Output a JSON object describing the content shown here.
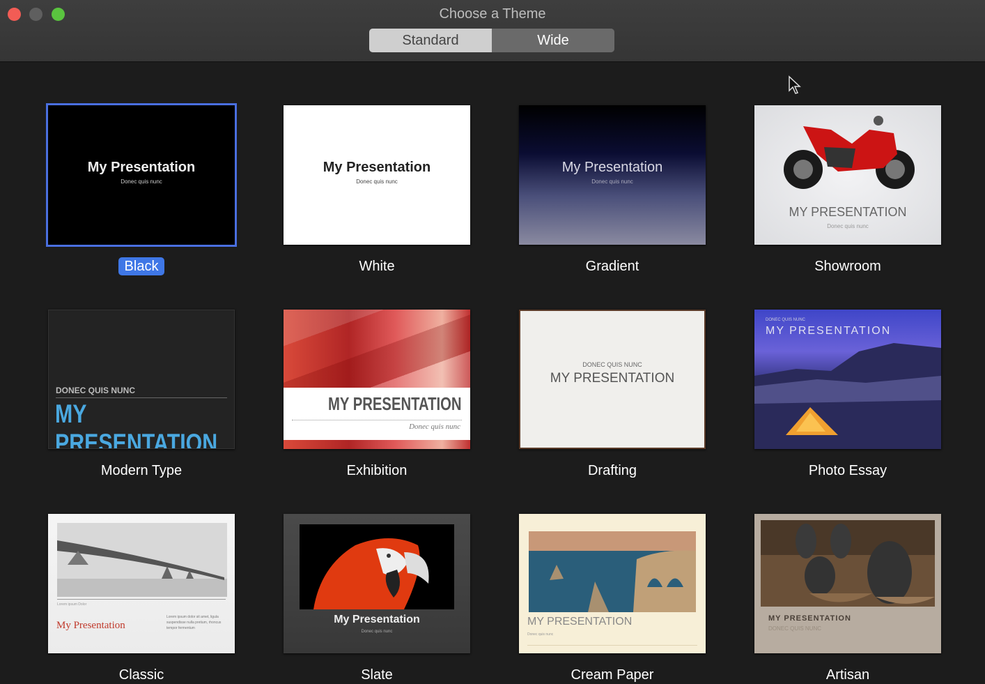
{
  "window": {
    "title": "Choose a Theme",
    "controls": [
      "close",
      "minimize",
      "zoom"
    ]
  },
  "segmented": {
    "options": [
      {
        "label": "Standard",
        "selected": true
      },
      {
        "label": "Wide",
        "selected": false
      }
    ]
  },
  "themes": [
    {
      "name": "Black",
      "selected": true,
      "title": "My Presentation",
      "subtitle": "Donec quis nunc"
    },
    {
      "name": "White",
      "selected": false,
      "title": "My Presentation",
      "subtitle": "Donec quis nunc"
    },
    {
      "name": "Gradient",
      "selected": false,
      "title": "My Presentation",
      "subtitle": "Donec quis nunc"
    },
    {
      "name": "Showroom",
      "selected": false,
      "title": "MY PRESENTATION",
      "subtitle": "Donec quis nunc"
    },
    {
      "name": "Modern Type",
      "selected": false,
      "title": "MY PRESENTATION",
      "subtitle": "DONEC QUIS NUNC"
    },
    {
      "name": "Exhibition",
      "selected": false,
      "title": "MY PRESENTATION",
      "subtitle": "Donec quis nunc"
    },
    {
      "name": "Drafting",
      "selected": false,
      "title": "MY PRESENTATION",
      "subtitle": "DONEC QUIS NUNC"
    },
    {
      "name": "Photo Essay",
      "selected": false,
      "title": "MY PRESENTATION",
      "subtitle": "DONEC QUIS NUNC"
    },
    {
      "name": "Classic",
      "selected": false,
      "title": "My Presentation",
      "subtitle": "Lorem ipsum dolor sit amet, ligula suspendisse nulla pretium, rhoncus tempor fermentum",
      "caption": "Lorem ipsum Dolor"
    },
    {
      "name": "Slate",
      "selected": false,
      "title": "My Presentation",
      "subtitle": "Donec quis nunc"
    },
    {
      "name": "Cream Paper",
      "selected": false,
      "title": "MY PRESENTATION",
      "subtitle": "Donec quis nunc"
    },
    {
      "name": "Artisan",
      "selected": false,
      "title": "MY PRESENTATION",
      "subtitle": "DONEC QUIS NUNC"
    }
  ],
  "colors": {
    "selection_accent": "#3f77e6",
    "modern_type_title": "#4aa8e0",
    "classic_title": "#c0392b"
  }
}
